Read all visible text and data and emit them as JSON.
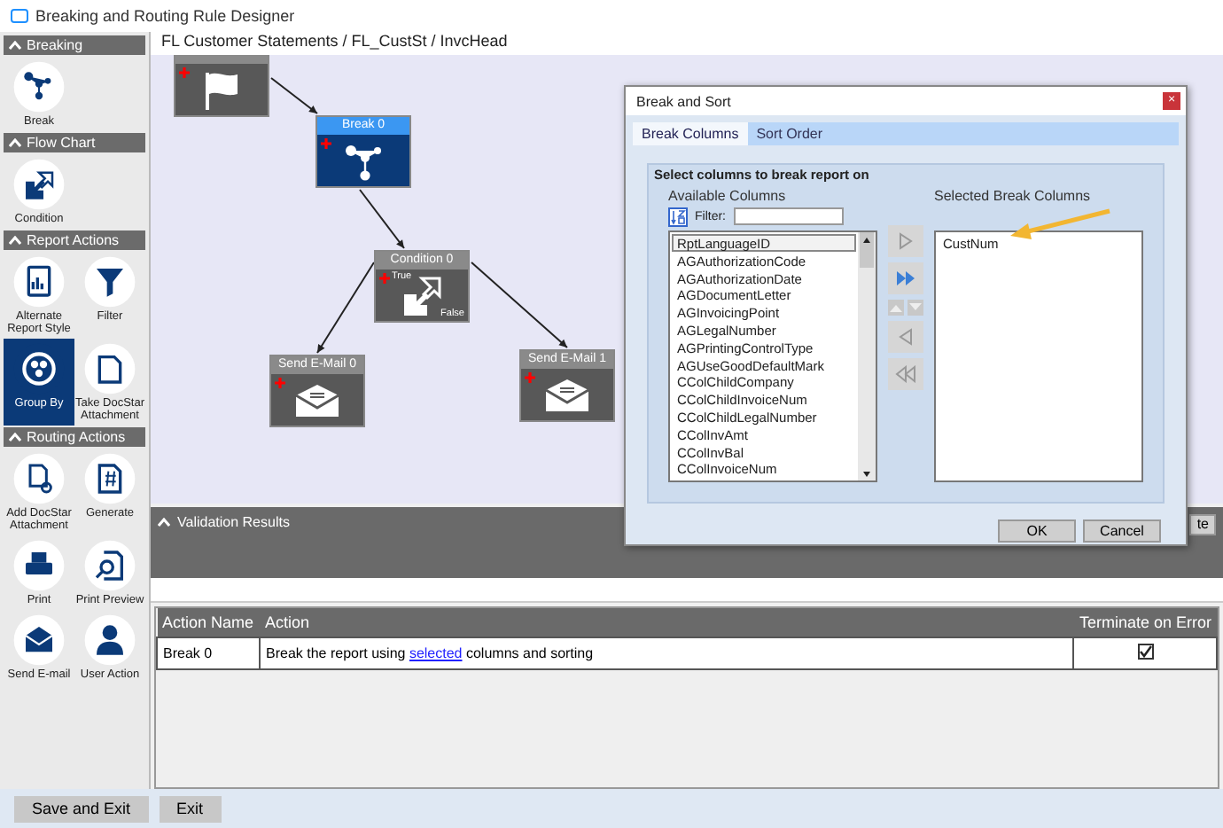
{
  "window": {
    "title": "Breaking and Routing Rule Designer"
  },
  "sidebar": {
    "sections": [
      {
        "title": "Breaking",
        "expanded": true,
        "items": [
          {
            "label": "Break",
            "selected": false
          }
        ]
      },
      {
        "title": "Flow Chart",
        "expanded": true,
        "items": [
          {
            "label": "Condition",
            "selected": false
          }
        ]
      },
      {
        "title": "Report Actions",
        "expanded": true,
        "items": [
          {
            "label": "Alternate Report Style",
            "selected": false
          },
          {
            "label": "Filter",
            "selected": false
          },
          {
            "label": "Group By",
            "selected": true
          },
          {
            "label": "Take DocStar Attachment",
            "selected": false
          }
        ]
      },
      {
        "title": "Routing Actions",
        "expanded": true,
        "items": [
          {
            "label": "Add DocStar Attachment",
            "selected": false
          },
          {
            "label": "Generate",
            "selected": false
          },
          {
            "label": "Print",
            "selected": false
          },
          {
            "label": "Print Preview",
            "selected": false
          },
          {
            "label": "Send E-mail",
            "selected": false
          },
          {
            "label": "User Action",
            "selected": false
          }
        ]
      }
    ]
  },
  "breadcrumb": "FL Customer Statements / FL_CustSt / InvcHead",
  "flow_nodes": [
    {
      "kind": "start",
      "selected": false
    },
    {
      "kind": "break",
      "title": "Break 0",
      "selected": true
    },
    {
      "kind": "condition",
      "title": "Condition 0",
      "selected": false,
      "true_label": "True",
      "false_label": "False"
    },
    {
      "kind": "mail",
      "title": "Send E-Mail 0",
      "selected": false
    },
    {
      "kind": "mail",
      "title": "Send E-Mail 1",
      "selected": false
    }
  ],
  "validation": {
    "title": "Validation Results",
    "expanded": true,
    "button": "te"
  },
  "table": {
    "columns": [
      "Action Name",
      "Action",
      "Terminate on Error"
    ],
    "rows": [
      {
        "name": "Break 0",
        "action_before": "Break the report using",
        "action_link": "selected",
        "action_after": "columns and sorting",
        "terminate": true
      }
    ]
  },
  "dialog": {
    "title": "Break and Sort",
    "close": "×",
    "tabs": [
      {
        "label": "Break Columns",
        "selected": true
      },
      {
        "label": "Sort Order",
        "selected": false
      }
    ],
    "group_title": "Select columns to break report on",
    "available_label": "Available Columns",
    "filter_label": "Filter:",
    "available": [
      {
        "name": "RptLanguageID",
        "selected": true
      },
      {
        "name": "AGAuthorizationCode",
        "selected": false
      },
      {
        "name": "AGAuthorizationDate",
        "selected": false
      },
      {
        "name": "AGDocumentLetter",
        "selected": false
      },
      {
        "name": "AGInvoicingPoint",
        "selected": false
      },
      {
        "name": "AGLegalNumber",
        "selected": false
      },
      {
        "name": "AGPrintingControlType",
        "selected": false
      },
      {
        "name": "AGUseGoodDefaultMark",
        "selected": false
      },
      {
        "name": "CColChildCompany",
        "selected": false
      },
      {
        "name": "CColChildInvoiceNum",
        "selected": false
      },
      {
        "name": "CColChildLegalNumber",
        "selected": false
      },
      {
        "name": "CColInvAmt",
        "selected": false
      },
      {
        "name": "CColInvBal",
        "selected": false
      },
      {
        "name": "CColInvoiceNum",
        "selected": false
      }
    ],
    "selected_label": "Selected Break Columns",
    "selected_columns": [
      "CustNum"
    ],
    "buttons": [
      "OK",
      "Cancel"
    ]
  },
  "footer": {
    "buttons": [
      "Save and Exit",
      "Exit"
    ]
  }
}
